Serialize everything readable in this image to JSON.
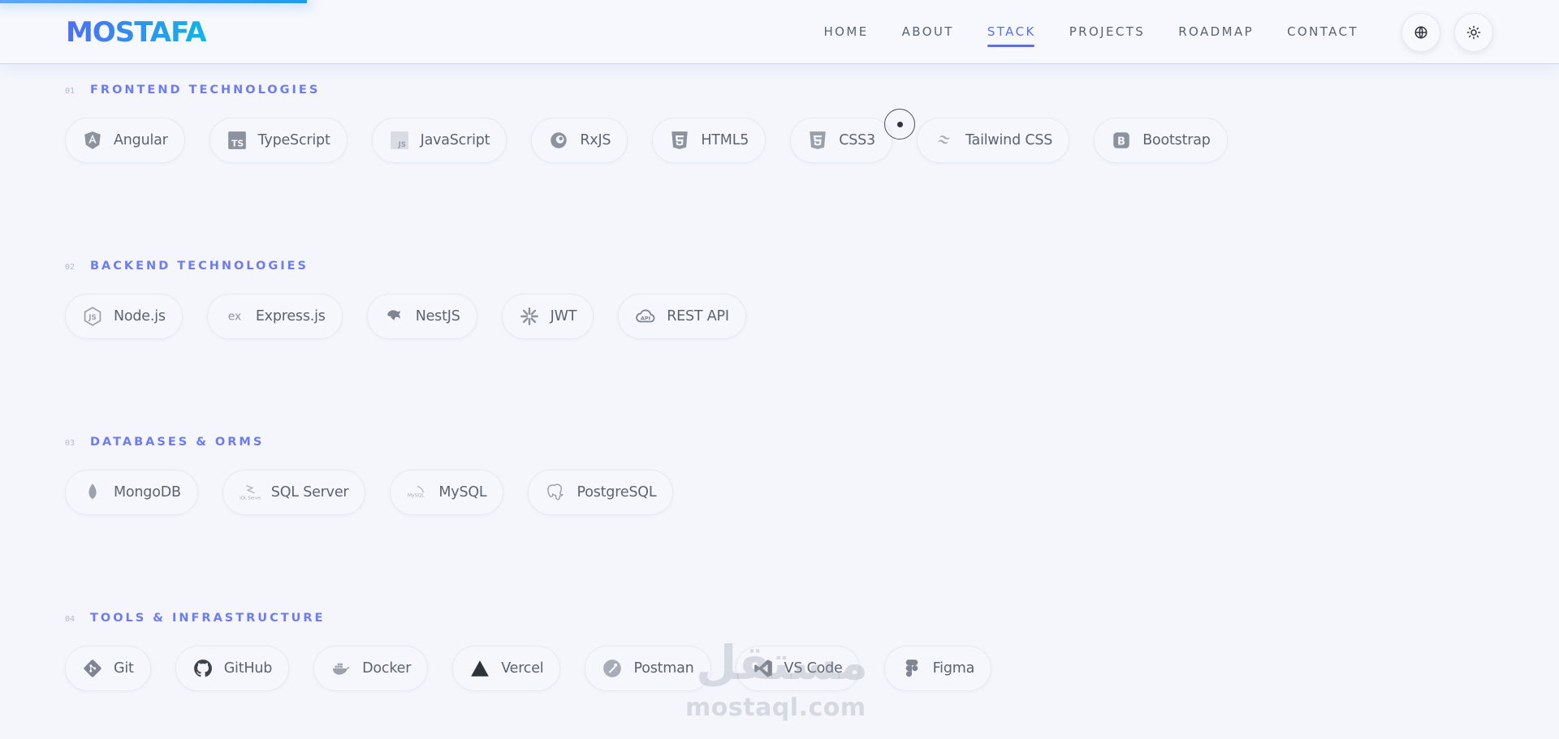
{
  "header": {
    "logo": "MOSTAFA",
    "nav": [
      {
        "label": "HOME",
        "active": false
      },
      {
        "label": "ABOUT",
        "active": false
      },
      {
        "label": "STACK",
        "active": true
      },
      {
        "label": "PROJECTS",
        "active": false
      },
      {
        "label": "ROADMAP",
        "active": false
      },
      {
        "label": "CONTACT",
        "active": false
      }
    ],
    "buttons": [
      {
        "icon": "globe-icon"
      },
      {
        "icon": "sun-icon"
      }
    ]
  },
  "colors": {
    "accent": "#5b6ef0",
    "logo_gradient_start": "#4f6df5",
    "logo_gradient_end": "#10b5e6",
    "background": "#f4f6fc"
  },
  "sections": [
    {
      "number": "01",
      "title": "FRONTEND TECHNOLOGIES",
      "items": [
        {
          "label": "Angular",
          "icon": "angular-icon"
        },
        {
          "label": "TypeScript",
          "icon": "typescript-icon"
        },
        {
          "label": "JavaScript",
          "icon": "javascript-icon"
        },
        {
          "label": "RxJS",
          "icon": "rxjs-icon"
        },
        {
          "label": "HTML5",
          "icon": "html5-icon"
        },
        {
          "label": "CSS3",
          "icon": "css3-icon"
        },
        {
          "label": "Tailwind CSS",
          "icon": "tailwind-icon"
        },
        {
          "label": "Bootstrap",
          "icon": "bootstrap-icon"
        }
      ]
    },
    {
      "number": "02",
      "title": "BACKEND TECHNOLOGIES",
      "items": [
        {
          "label": "Node.js",
          "icon": "nodejs-icon"
        },
        {
          "label": "Express.js",
          "icon": "express-icon"
        },
        {
          "label": "NestJS",
          "icon": "nestjs-icon"
        },
        {
          "label": "JWT",
          "icon": "jwt-icon"
        },
        {
          "label": "REST API",
          "icon": "rest-api-icon"
        }
      ]
    },
    {
      "number": "03",
      "title": "DATABASES & ORMS",
      "items": [
        {
          "label": "MongoDB",
          "icon": "mongodb-icon"
        },
        {
          "label": "SQL Server",
          "icon": "sql-server-icon"
        },
        {
          "label": "MySQL",
          "icon": "mysql-icon"
        },
        {
          "label": "PostgreSQL",
          "icon": "postgresql-icon"
        }
      ]
    },
    {
      "number": "04",
      "title": "TOOLS & INFRASTRUCTURE",
      "items": [
        {
          "label": "Git",
          "icon": "git-icon"
        },
        {
          "label": "GitHub",
          "icon": "github-icon"
        },
        {
          "label": "Docker",
          "icon": "docker-icon"
        },
        {
          "label": "Vercel",
          "icon": "vercel-icon"
        },
        {
          "label": "Postman",
          "icon": "postman-icon"
        },
        {
          "label": "VS Code",
          "icon": "vscode-icon"
        },
        {
          "label": "Figma",
          "icon": "figma-icon"
        }
      ]
    }
  ],
  "watermark": {
    "arabic": "مستقل",
    "latin": "mostaql.com"
  }
}
